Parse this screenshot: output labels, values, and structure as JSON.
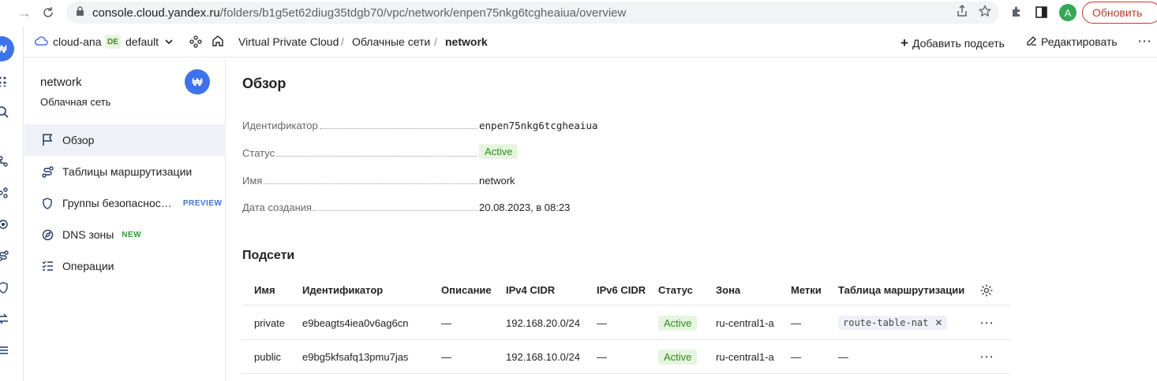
{
  "browser": {
    "url_host": "console.cloud.yandex.ru",
    "url_path": "/folders/b1g5et62diug35tdgb70/vpc/network/enpen75nkg6tcgheaiua/overview",
    "refresh_label": "Обновить",
    "profile_initial": "A"
  },
  "topbar": {
    "cloud": "cloud-ana",
    "folder_badge": "DE",
    "folder": "default",
    "breadcrumbs": [
      "Virtual Private Cloud",
      "Облачные сети",
      "network"
    ],
    "add_subnet": "Добавить подсеть",
    "edit": "Редактировать"
  },
  "sidebar": {
    "title": "network",
    "subtitle": "Облачная сеть",
    "items": [
      {
        "label": "Обзор"
      },
      {
        "label": "Таблицы маршрутизации"
      },
      {
        "label": "Группы безопаснос…",
        "badge": "PREVIEW"
      },
      {
        "label": "DNS зоны",
        "badge": "NEW"
      },
      {
        "label": "Операции"
      }
    ]
  },
  "overview": {
    "title": "Обзор",
    "fields": [
      {
        "label": "Идентификатор",
        "value": "enpen75nkg6tcgheaiua"
      },
      {
        "label": "Статус",
        "value": "Active"
      },
      {
        "label": "Имя",
        "value": "network"
      },
      {
        "label": "Дата создания",
        "value": "20.08.2023, в 08:23"
      }
    ]
  },
  "subnets": {
    "title": "Подсети",
    "columns": [
      "Имя",
      "Идентификатор",
      "Описание",
      "IPv4 CIDR",
      "IPv6 CIDR",
      "Статус",
      "Зона",
      "Метки",
      "Таблица маршрутизации"
    ],
    "rows": [
      [
        "private",
        "e9beagts4iea0v6ag6cn",
        "—",
        "192.168.20.0/24",
        "—",
        "Active",
        "ru-central1-a",
        "—",
        "route-table-nat"
      ],
      [
        "public",
        "e9bg5kfsafq13pmu7jas",
        "—",
        "192.168.10.0/24",
        "—",
        "Active",
        "ru-central1-a",
        "—",
        "—"
      ]
    ]
  }
}
